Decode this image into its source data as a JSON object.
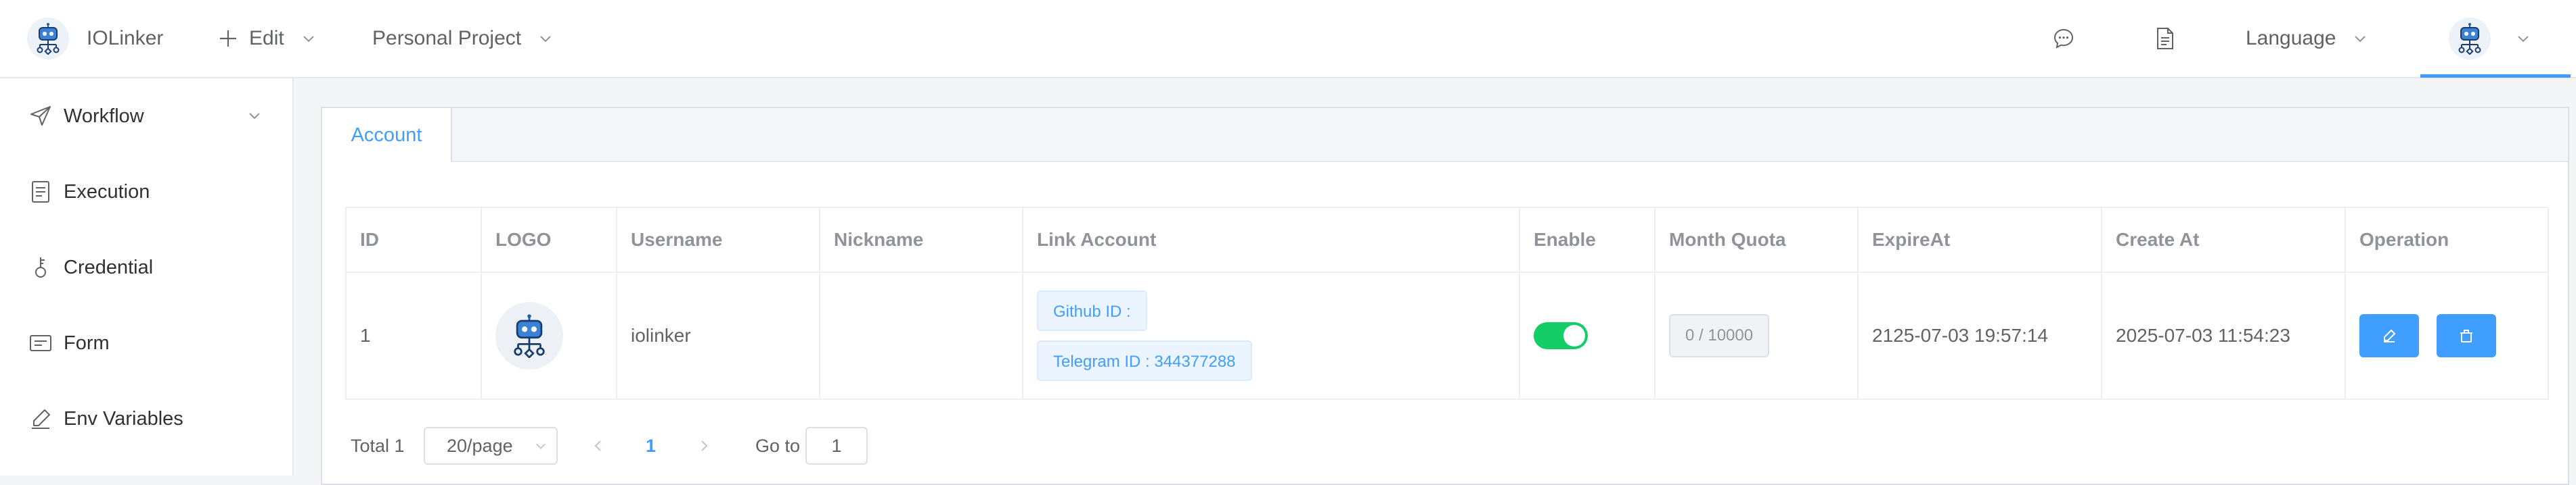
{
  "header": {
    "brand": "IOLinker",
    "edit_label": "Edit",
    "project_label": "Personal Project",
    "language_label": "Language",
    "accent": "#409eff"
  },
  "sidebar": {
    "items": [
      {
        "label": "Workflow",
        "icon": "send-icon"
      },
      {
        "label": "Execution",
        "icon": "document-icon"
      },
      {
        "label": "Credential",
        "icon": "key-icon"
      },
      {
        "label": "Form",
        "icon": "form-icon"
      },
      {
        "label": "Env Variables",
        "icon": "pen-icon"
      }
    ]
  },
  "tabs": [
    {
      "label": "Account",
      "active": true
    }
  ],
  "table": {
    "columns": [
      "ID",
      "LOGO",
      "Username",
      "Nickname",
      "Link Account",
      "Enable",
      "Month Quota",
      "ExpireAt",
      "Create At",
      "Operation"
    ],
    "rows": [
      {
        "id": "1",
        "username": "iolinker",
        "nickname": "",
        "github": "Github ID :",
        "telegram": "Telegram ID : 344377288",
        "enabled": true,
        "quota": "0 / 10000",
        "expire_at": "2125-07-03 19:57:14",
        "create_at": "2025-07-03 11:54:23"
      }
    ]
  },
  "pagination": {
    "total": "Total 1",
    "page_size": "20/page",
    "current_page": "1",
    "goto_label": "Go to",
    "goto_value": "1"
  },
  "colors": {
    "primary": "#409eff",
    "success": "#13ce66"
  }
}
